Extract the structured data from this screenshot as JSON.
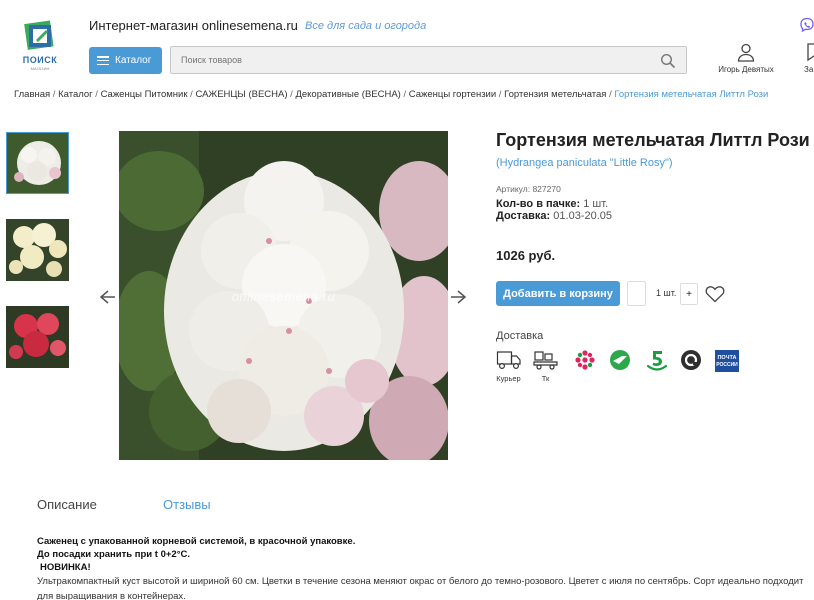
{
  "header": {
    "logo_text": "ПОИСК",
    "logo_sub": "МАГАЗИН",
    "store_name": "Интернет-магазин onlinesemena.ru",
    "tagline": "Все для сада и огорода",
    "catalog_label": "Каталог",
    "search_placeholder": "Поиск товаров",
    "user_name": "Игорь Девятых",
    "favorites_label": "За"
  },
  "breadcrumb": [
    "Главная",
    "Каталог",
    "Саженцы Питомник",
    "САЖЕНЦЫ (ВЕСНА)",
    "Декоративные (ВЕСНА)",
    "Саженцы гортензии",
    "Гортензия метельчатая",
    "Гортензия метельчатая Литтл Рози"
  ],
  "gallery": {
    "watermark": "onlinesemena.ru",
    "thumbnails": [
      "hydrangea-white-pink",
      "hydrangea-cream",
      "hydrangea-red"
    ]
  },
  "product": {
    "title": "Гортензия метельчатая Литтл Рози",
    "latin_name": "(Hydrangea paniculata \"Little Rosy\")",
    "sku_label": "Артикул:",
    "sku_value": "827270",
    "pack_label": "Кол-во в пачке:",
    "pack_value": "1 шт.",
    "delivery_label": "Доставка:",
    "delivery_value": "01.03-20.05",
    "price": "1026 руб.",
    "add_to_cart": "Добавить в корзину",
    "qty": "1 шт.",
    "qty_plus": "+"
  },
  "delivery": {
    "heading": "Доставка",
    "methods": [
      {
        "name": "Курьер",
        "icon": "truck-icon"
      },
      {
        "name": "Тк",
        "icon": "cargo-icon"
      },
      {
        "name": "",
        "icon": "cdek-flower-icon"
      },
      {
        "name": "",
        "icon": "boxberry-icon"
      },
      {
        "name": "",
        "icon": "pyaterochka-icon"
      },
      {
        "name": "",
        "icon": "ozon-icon"
      },
      {
        "name": "",
        "icon": "russian-post-icon"
      }
    ],
    "post_logo_text": "ПОЧТА РОССИИ"
  },
  "tabs": {
    "description": "Описание",
    "reviews": "Отзывы"
  },
  "description": {
    "line1": "Саженец с упакованной корневой системой, в красочной упаковке.",
    "line2": "До посадки хранить при t 0+2°C.",
    "line3": "НОВИНКА!",
    "body": "Ультракомпактный куст высотой и шириной 60 см. Цветки в течение сезона меняют окрас от белого до темно-розового. Цветет с июля по сентябрь. Сорт идеально подходит для выращивания в контейнерах."
  },
  "colors": {
    "accent": "#4a9ad6",
    "logo_green": "#3aaa5c",
    "logo_blue": "#2c6da6"
  }
}
